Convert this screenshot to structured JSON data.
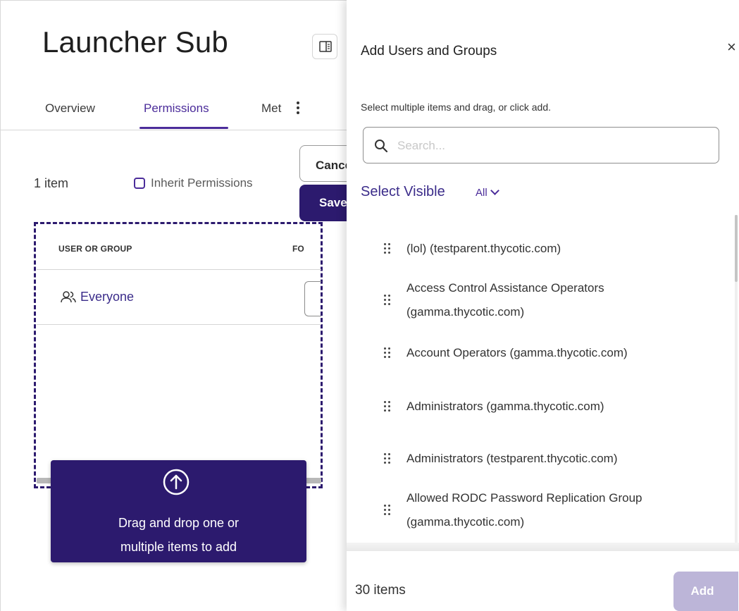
{
  "page": {
    "title": "Launcher Sub",
    "tabs": [
      {
        "label": "Overview"
      },
      {
        "label": "Permissions",
        "active": true
      },
      {
        "label": "Met"
      }
    ],
    "item_count": "1 item",
    "inherit_permissions_label": "Inherit Permissions",
    "inherit_permissions_checked": false,
    "cancel_label": "Cancel",
    "save_label": "Save",
    "table": {
      "columns": [
        "USER OR GROUP",
        "FO"
      ],
      "rows": [
        {
          "name": "Everyone"
        }
      ]
    },
    "drag_overlay": {
      "line1": "Drag and drop one or",
      "line2": "multiple items to add"
    }
  },
  "drawer": {
    "title": "Add Users and Groups",
    "close_label": "×",
    "hint": "Select multiple items and drag, or click add.",
    "search_placeholder": "Search...",
    "select_visible_label": "Select Visible",
    "select_all_label": "All",
    "items": [
      {
        "line1": "(lol) (testparent.thycotic.com)"
      },
      {
        "line1": "Access Control Assistance Operators",
        "line2": "(gamma.thycotic.com)"
      },
      {
        "line1": "Account Operators (gamma.thycotic.com)"
      },
      {
        "line1": "Administrators (gamma.thycotic.com)"
      },
      {
        "line1": "Administrators (testparent.thycotic.com)"
      },
      {
        "line1": "Allowed RODC Password Replication Group",
        "line2": "(gamma.thycotic.com)"
      }
    ],
    "footer_count": "30 items",
    "add_label": "Add"
  },
  "colors": {
    "accent": "#4b2c9a",
    "primary_dark": "#2c1a6e",
    "add_disabled": "#bcb5d8"
  },
  "icons": [
    "panel-toggle-icon",
    "more-vertical-icon",
    "users-icon",
    "upload-arrow-icon",
    "search-icon",
    "drag-handle-icon",
    "close-icon",
    "chevron-down-icon"
  ]
}
